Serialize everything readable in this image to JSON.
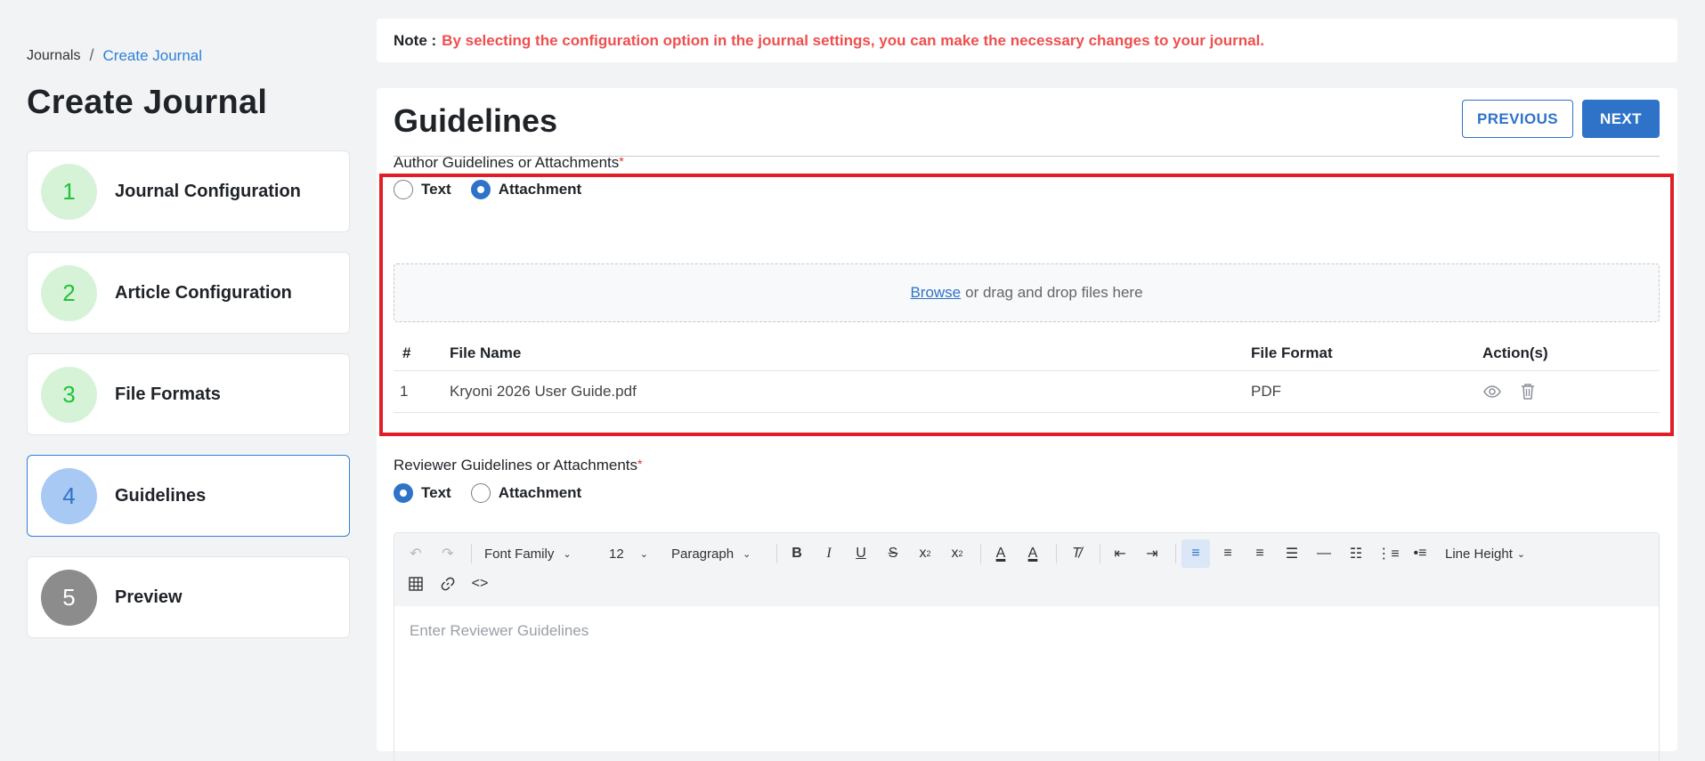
{
  "breadcrumb": {
    "root": "Journals",
    "separator": "/",
    "current": "Create Journal"
  },
  "page_title": "Create Journal",
  "steps": [
    {
      "number": "1",
      "label": "Journal Configuration",
      "state": "completed"
    },
    {
      "number": "2",
      "label": "Article Configuration",
      "state": "completed"
    },
    {
      "number": "3",
      "label": "File Formats",
      "state": "completed"
    },
    {
      "number": "4",
      "label": "Guidelines",
      "state": "active"
    },
    {
      "number": "5",
      "label": "Preview",
      "state": "pending"
    }
  ],
  "note": {
    "label": "Note :",
    "text": "By selecting the configuration option in the journal settings, you can make the necessary changes to your journal."
  },
  "panel": {
    "title": "Guidelines",
    "previous_label": "PREVIOUS",
    "next_label": "NEXT"
  },
  "author": {
    "label": "Author Guidelines or Attachments",
    "required_mark": "*",
    "options": {
      "text": "Text",
      "attachment": "Attachment"
    },
    "selected": "attachment",
    "dropzone": {
      "browse": "Browse",
      "rest": "or drag and drop files here"
    },
    "table": {
      "headers": {
        "num": "#",
        "name": "File Name",
        "format": "File Format",
        "actions": "Action(s)"
      },
      "rows": [
        {
          "num": "1",
          "name": "Kryoni 2026 User Guide.pdf",
          "format": "PDF"
        }
      ]
    }
  },
  "reviewer": {
    "label": "Reviewer Guidelines or Attachments",
    "required_mark": "*",
    "options": {
      "text": "Text",
      "attachment": "Attachment"
    },
    "selected": "text",
    "editor": {
      "font_family": "Font Family",
      "font_size": "12",
      "block_format": "Paragraph",
      "line_height": "Line Height",
      "placeholder": "Enter Reviewer Guidelines"
    }
  },
  "colors": {
    "accent": "#2f73c8",
    "note_text": "#f04e4e",
    "highlight_border": "#e01e28",
    "step_completed_bg": "#d6f3d8",
    "step_completed_fg": "#22c23a"
  }
}
